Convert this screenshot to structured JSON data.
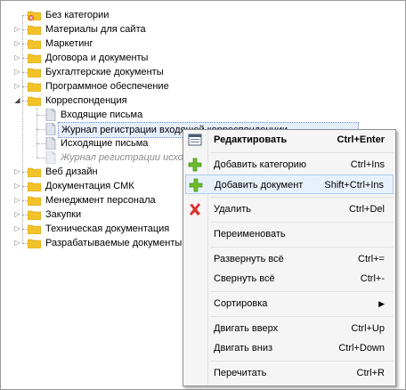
{
  "tree": {
    "items": [
      {
        "label": "Без категории",
        "icon": "folder-no-category-icon"
      },
      {
        "label": "Материалы для сайта",
        "icon": "folder-icon"
      },
      {
        "label": "Маркетинг",
        "icon": "folder-icon"
      },
      {
        "label": "Договора и документы",
        "icon": "folder-icon"
      },
      {
        "label": "Бухгалтерские документы",
        "icon": "folder-icon"
      },
      {
        "label": "Программное обеспечение",
        "icon": "folder-icon"
      },
      {
        "label": "Корреспонденция",
        "icon": "folder-icon",
        "expanded": true
      },
      {
        "label": "Входящие письма",
        "icon": "document-icon"
      },
      {
        "label": "Журнал регистрации входящей корреспонденции",
        "icon": "document-icon",
        "selected": true
      },
      {
        "label": "Исходящие письма",
        "icon": "document-icon"
      },
      {
        "label": "Журнал регистрации исходящей корреспонденции",
        "icon": "document-icon",
        "disabled": true
      },
      {
        "label": "Веб дизайн",
        "icon": "folder-icon"
      },
      {
        "label": "Документация СМК",
        "icon": "folder-icon"
      },
      {
        "label": "Менеджмент персонала",
        "icon": "folder-icon"
      },
      {
        "label": "Закупки",
        "icon": "folder-icon"
      },
      {
        "label": "Техническая документация",
        "icon": "folder-icon"
      },
      {
        "label": "Разрабатываемые документы",
        "icon": "folder-icon"
      }
    ]
  },
  "menu": {
    "items": [
      {
        "label": "Редактировать",
        "shortcut": "Ctrl+Enter",
        "icon": "edit-icon",
        "bold": true
      },
      {
        "label": "Добавить категорию",
        "shortcut": "Ctrl+Ins",
        "icon": "plus-icon"
      },
      {
        "label": "Добавить документ",
        "shortcut": "Shift+Ctrl+Ins",
        "icon": "plus-icon",
        "highlighted": true
      },
      {
        "label": "Удалить",
        "shortcut": "Ctrl+Del",
        "icon": "delete-x-icon"
      },
      {
        "label": "Переименовать",
        "shortcut": ""
      },
      {
        "label": "Развернуть всё",
        "shortcut": "Ctrl+="
      },
      {
        "label": "Свернуть всё",
        "shortcut": "Ctrl+-"
      },
      {
        "label": "Сортировка",
        "shortcut": "",
        "submenu": true
      },
      {
        "label": "Двигать вверх",
        "shortcut": "Ctrl+Up"
      },
      {
        "label": "Двигать вниз",
        "shortcut": "Ctrl+Down"
      },
      {
        "label": "Перечитать",
        "shortcut": "Ctrl+R"
      }
    ]
  },
  "colors": {
    "folder": "#f2c229",
    "plus": "#6cbf2a",
    "delete": "#d9322c",
    "highlight": "#e8f1fb"
  }
}
